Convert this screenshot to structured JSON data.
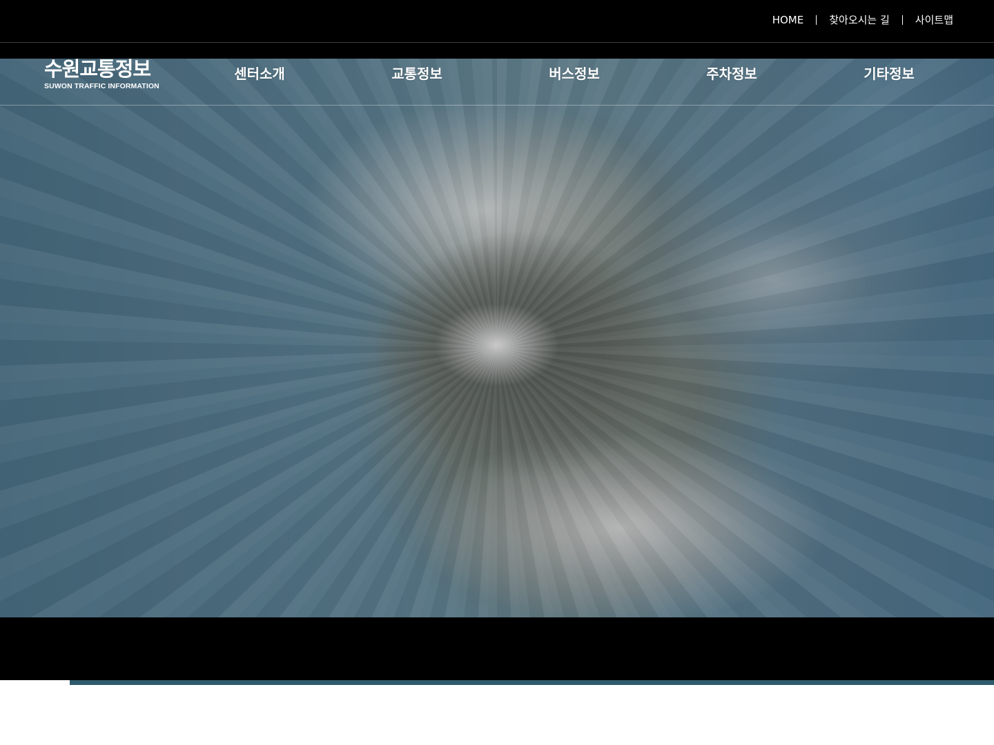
{
  "util_nav": {
    "home": "HOME",
    "directions": "찾아오시는 길",
    "sitemap": "사이트맵"
  },
  "logo": {
    "title_ko": "수원교통정보",
    "subtitle_en": "SUWON TRAFFIC INFORMATION"
  },
  "gnb": {
    "items": [
      {
        "label": "센터소개"
      },
      {
        "label": "교통정보"
      },
      {
        "label": "버스정보"
      },
      {
        "label": "주차정보"
      },
      {
        "label": "기타정보"
      }
    ]
  },
  "hero": {
    "media": "satellite-video"
  },
  "progress": {
    "fraction": 0.93,
    "color": "#2f5b6b"
  }
}
